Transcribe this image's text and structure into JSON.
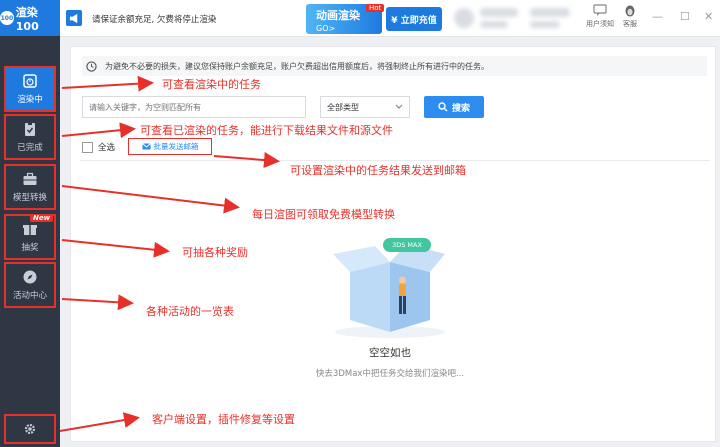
{
  "app": {
    "logo_text": "渲染100",
    "logo_mark": "100"
  },
  "sidebar": {
    "items": [
      {
        "label": "渲染中"
      },
      {
        "label": "已完成"
      },
      {
        "label": "模型转换"
      },
      {
        "label": "抽奖"
      },
      {
        "label": "活动中心"
      }
    ],
    "new_badge": "New"
  },
  "topbar": {
    "notice": "请保证余额充足, 欠费将停止渲染",
    "promo_title": "动画渲染",
    "promo_sub": "GO>",
    "promo_badge": "Hot",
    "recharge_label": "¥ 立即充值",
    "links": [
      {
        "label": "用户须知"
      },
      {
        "label": "客服"
      }
    ],
    "window": {
      "minimize": "—",
      "maximize": "☐",
      "close": "✕"
    }
  },
  "content": {
    "tip": "为避免不必要的损失，建议您保持账户余额充足，账户欠费超出信用额度后，将强制终止所有进行中的任务。",
    "search_placeholder": "请输入关键字，为空则匹配所有",
    "type_select": "全部类型",
    "search_button": "搜索",
    "select_all": "全选",
    "batch_email": "批量发送邮箱",
    "badge_3dsmax": "3DS MAX",
    "empty_title": "空空如也",
    "empty_sub": "快去3DMax中把任务交给我们渲染吧..."
  },
  "annotations": [
    "可查看渲染中的任务",
    "可查看已渲染的任务，能进行下载结果文件和源文件",
    "可设置渲染中的任务结果发送到邮箱",
    "每日渲图可领取免费模型转换",
    "可抽各种奖励",
    "各种活动的一览表",
    "客户端设置，插件修复等设置"
  ],
  "colors": {
    "accent": "#1f7ae0",
    "annotation": "#e8302a",
    "sidebar": "#2f3744"
  }
}
